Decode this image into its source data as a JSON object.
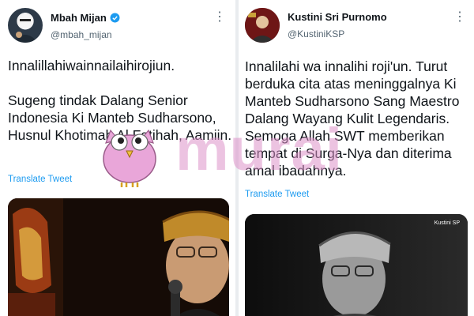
{
  "tweets": [
    {
      "author_name": "Mbah Mijan",
      "handle": "@mbah_mijan",
      "verified": true,
      "text_lines_1": "Innalillahiwainnailaihirojiun.",
      "text_lines_2": "Sugeng tindak Dalang Senior Indonesia Ki Manteb Sudharsono, Husnul Khotimah Al Fatihah, Aamiin.",
      "translate_label": "Translate Tweet",
      "more_icon": "more-icon"
    },
    {
      "author_name": "Kustini Sri Purnomo",
      "handle": "@KustiniKSP",
      "verified": false,
      "text": "Innalilahi wa innalihi roji'un. Turut berduka cita atas meninggalnya Ki Manteb Sudharsono Sang Maestro Dalang Wayang Kulit Legendaris. Semoga Allah SWT memberikan tempat di Surga-Nya dan diterima amal ibadahnya.",
      "translate_label": "Translate Tweet",
      "media_caption": "Kustini SP",
      "more_icon": "more-icon"
    }
  ],
  "watermark": {
    "text": "murai",
    "color": "#dd92c9"
  },
  "colors": {
    "link": "#1d9bf0",
    "text": "#0f1419",
    "secondary": "#536471",
    "verified": "#1d9bf0"
  }
}
